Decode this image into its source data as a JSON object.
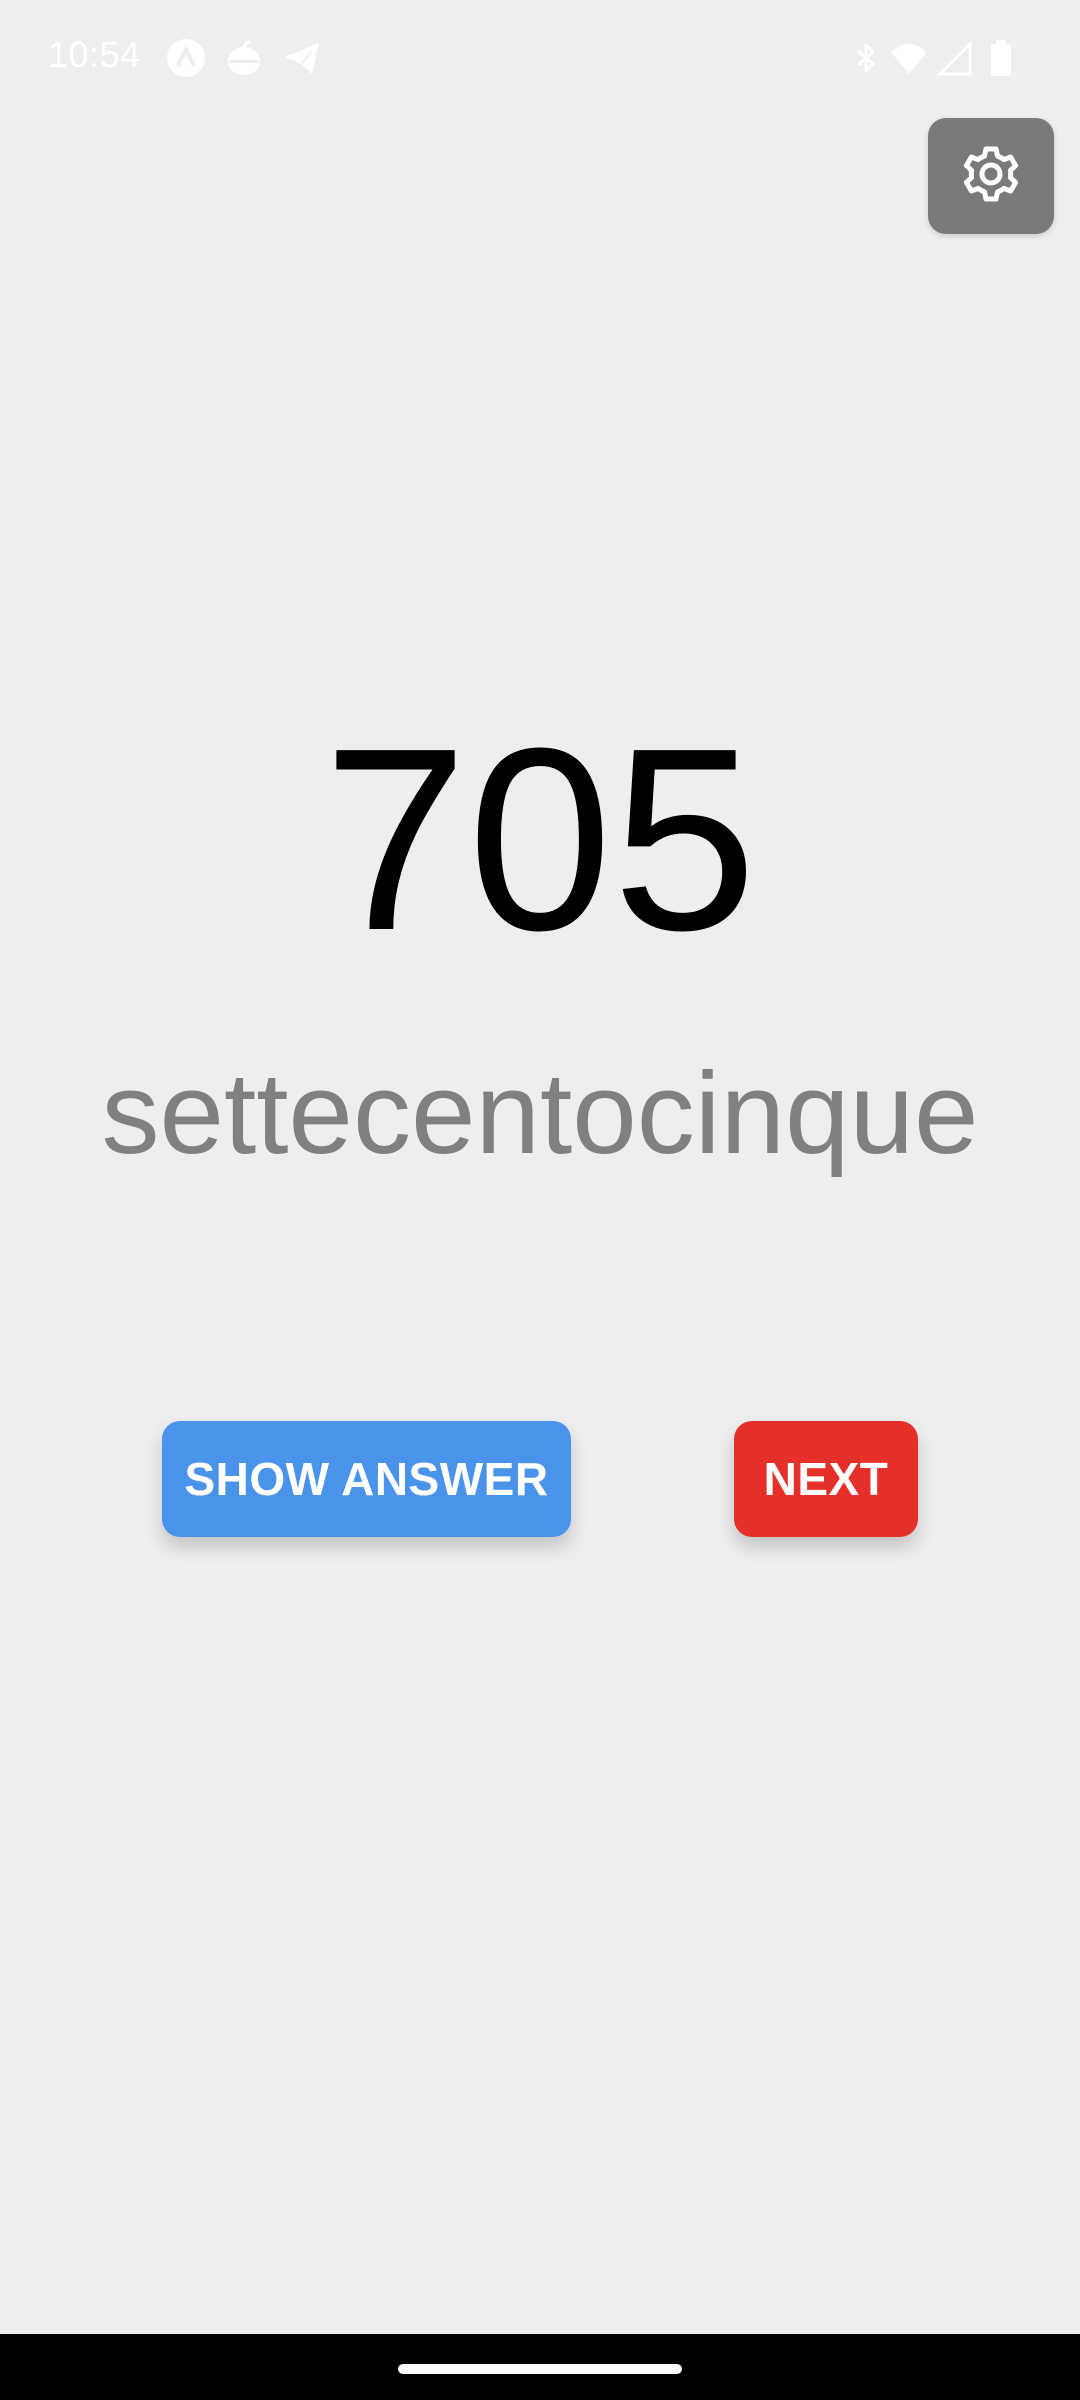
{
  "status_bar": {
    "time": "10:54",
    "left_icons": [
      "a-circle-icon",
      "apple-icon",
      "telegram-send-icon"
    ],
    "right_icons": [
      "bluetooth-icon",
      "wifi-icon",
      "cellular-signal-icon",
      "battery-icon"
    ]
  },
  "settings": {
    "icon": "gear-icon"
  },
  "main": {
    "number": "705",
    "words": "settecentocinque"
  },
  "buttons": {
    "show_answer_label": "SHOW ANSWER",
    "next_label": "NEXT"
  },
  "colors": {
    "background": "#eeeeee",
    "show_answer": "#4a93eb",
    "next": "#e5302a",
    "settings_bg": "#7a7a7a",
    "words_text": "#808080"
  }
}
